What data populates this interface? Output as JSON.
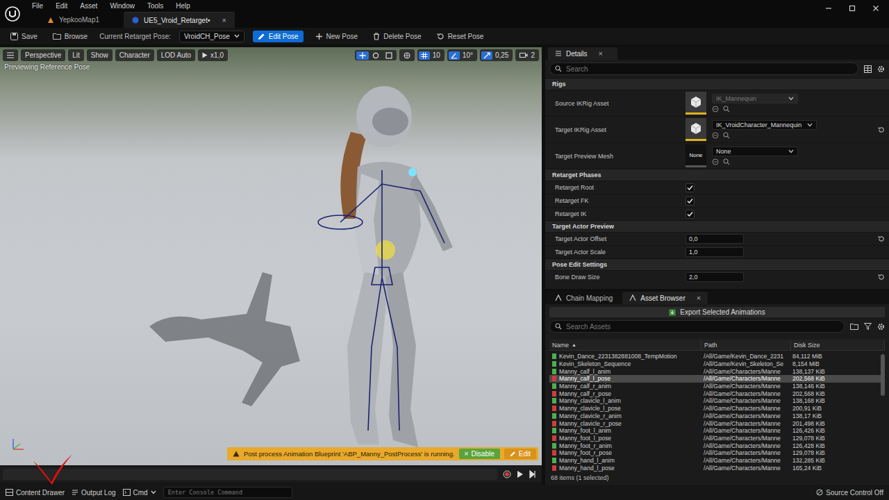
{
  "window": {
    "menus": [
      "File",
      "Edit",
      "Asset",
      "Window",
      "Tools",
      "Help"
    ],
    "tabs": [
      {
        "label": "YepkooMap1",
        "kind": "level",
        "selected": false,
        "close": ""
      },
      {
        "label": "UE5_Vroid_Retarget•",
        "kind": "asset",
        "selected": true,
        "close": "×"
      }
    ]
  },
  "toolbar": {
    "save": "Save",
    "browse": "Browse",
    "pose_label": "Current Retarget Pose:",
    "pose_value": "VroidCH_Pose",
    "buttons": [
      {
        "label": "Edit Pose",
        "kind": "edit",
        "selected": true
      },
      {
        "label": "New Pose",
        "kind": "new",
        "selected": false
      },
      {
        "label": "Delete Pose",
        "kind": "delete",
        "selected": false
      },
      {
        "label": "Reset Pose",
        "kind": "reset",
        "selected": false
      }
    ]
  },
  "viewport": {
    "buttons": [
      "Perspective",
      "Lit",
      "Show",
      "Character",
      "LOD Auto"
    ],
    "play": "x1,0",
    "transform_modes": [
      {
        "kind": "translate",
        "selected": true
      },
      {
        "kind": "rotate",
        "selected": false
      },
      {
        "kind": "scale",
        "selected": false
      }
    ],
    "snaps": [
      {
        "kind": "grid",
        "value": "10",
        "on": true
      },
      {
        "kind": "angle",
        "value": "10°",
        "on": true
      },
      {
        "kind": "scale",
        "value": "0,25",
        "on": true
      }
    ],
    "camera_speed": "2",
    "status": "Previewing Reference Pose",
    "warning": {
      "text": "Post process Animation Blueprint 'ABP_Manny_PostProcess' is running.",
      "disable_icon": "×",
      "disable": "Disable",
      "edit": "Edit"
    }
  },
  "details": {
    "tab": "Details",
    "close": "×",
    "search_placeholder": "Search",
    "sections": [
      {
        "title": "Rigs",
        "rows": [
          {
            "kind": "asset",
            "label": "Source IKRig Asset",
            "value": "IK_Mannequin",
            "thumb_text": "",
            "disabled": true,
            "reset": false
          },
          {
            "kind": "asset",
            "label": "Target IKRig Asset",
            "value": "IK_VroidCharacter_Mannequin",
            "thumb_text": "",
            "disabled": false,
            "reset": true
          },
          {
            "kind": "asset",
            "label": "Target Preview Mesh",
            "value": "None",
            "thumb_text": "None",
            "disabled": false,
            "reset": false
          }
        ]
      },
      {
        "title": "Retarget Phases",
        "rows": [
          {
            "kind": "checkbox",
            "label": "Retarget Root",
            "checked": true,
            "reset": false
          },
          {
            "kind": "checkbox",
            "label": "Retarget FK",
            "checked": true,
            "reset": false
          },
          {
            "kind": "checkbox",
            "label": "Retarget IK",
            "checked": true,
            "reset": false
          }
        ]
      },
      {
        "title": "Target Actor Preview",
        "rows": [
          {
            "kind": "number",
            "label": "Target Actor Offset",
            "value": "0,0",
            "reset": true
          },
          {
            "kind": "number",
            "label": "Target Actor Scale",
            "value": "1,0",
            "reset": false
          }
        ]
      },
      {
        "title": "Pose Edit Settings",
        "rows": [
          {
            "kind": "number",
            "label": "Bone Draw Size",
            "value": "2,0",
            "reset": true
          }
        ]
      }
    ]
  },
  "bottom_tabs": [
    {
      "label": "Chain Mapping",
      "selected": false,
      "close": ""
    },
    {
      "label": "Asset Browser",
      "selected": true,
      "close": "×"
    }
  ],
  "asset_browser": {
    "export": "Export Selected Animations",
    "search_placeholder": "Search Assets",
    "columns": [
      {
        "label": "Name",
        "sort": "▲"
      },
      {
        "label": "Path",
        "sort": ""
      },
      {
        "label": "Disk Size",
        "sort": ""
      }
    ],
    "rows": [
      {
        "name": "Kevin_Dance_2231382881008_TempMotion",
        "path": "/All/Game/Kevin_Dance_2231",
        "size": "84,112 MiB",
        "color": "#4caf50",
        "selected": false
      },
      {
        "name": "Kevin_Skeleton_Sequence",
        "path": "/All/Game/Kevin_Skeleton_Se",
        "size": "8,154 MiB",
        "color": "#4caf50",
        "selected": false
      },
      {
        "name": "Manny_calf_l_anim",
        "path": "/All/Game/Characters/Manne",
        "size": "138,137 KiB",
        "color": "#4caf50",
        "selected": false
      },
      {
        "name": "Manny_calf_l_pose",
        "path": "/All/Game/Characters/Manne",
        "size": "202,568 KiB",
        "color": "#d23b3b",
        "selected": true
      },
      {
        "name": "Manny_calf_r_anim",
        "path": "/All/Game/Characters/Manne",
        "size": "138,146 KiB",
        "color": "#4caf50",
        "selected": false
      },
      {
        "name": "Manny_calf_r_pose",
        "path": "/All/Game/Characters/Manne",
        "size": "202,568 KiB",
        "color": "#d23b3b",
        "selected": false
      },
      {
        "name": "Manny_clavicle_l_anim",
        "path": "/All/Game/Characters/Manne",
        "size": "138,168 KiB",
        "color": "#4caf50",
        "selected": false
      },
      {
        "name": "Manny_clavicle_l_pose",
        "path": "/All/Game/Characters/Manne",
        "size": "200,91 KiB",
        "color": "#d23b3b",
        "selected": false
      },
      {
        "name": "Manny_clavicle_r_anim",
        "path": "/All/Game/Characters/Manne",
        "size": "138,17 KiB",
        "color": "#4caf50",
        "selected": false
      },
      {
        "name": "Manny_clavicle_r_pose",
        "path": "/All/Game/Characters/Manne",
        "size": "201,498 KiB",
        "color": "#d23b3b",
        "selected": false
      },
      {
        "name": "Manny_foot_l_anim",
        "path": "/All/Game/Characters/Manne",
        "size": "126,426 KiB",
        "color": "#4caf50",
        "selected": false
      },
      {
        "name": "Manny_foot_l_pose",
        "path": "/All/Game/Characters/Manne",
        "size": "129,078 KiB",
        "color": "#d23b3b",
        "selected": false
      },
      {
        "name": "Manny_foot_r_anim",
        "path": "/All/Game/Characters/Manne",
        "size": "126,428 KiB",
        "color": "#4caf50",
        "selected": false
      },
      {
        "name": "Manny_foot_r_pose",
        "path": "/All/Game/Characters/Manne",
        "size": "129,078 KiB",
        "color": "#d23b3b",
        "selected": false
      },
      {
        "name": "Manny_hand_l_anim",
        "path": "/All/Game/Characters/Manne",
        "size": "132,285 KiB",
        "color": "#4caf50",
        "selected": false
      },
      {
        "name": "Manny_hand_l_pose",
        "path": "/All/Game/Characters/Manne",
        "size": "165,24 KiB",
        "color": "#d23b3b",
        "selected": false
      }
    ],
    "footer": "68 items (1 selected)"
  },
  "status_bar": {
    "content_drawer": "Content Drawer",
    "output_log": "Output Log",
    "cmd": "Cmd",
    "console_placeholder": "Enter Console Command",
    "source_control": "Source Control Off"
  }
}
